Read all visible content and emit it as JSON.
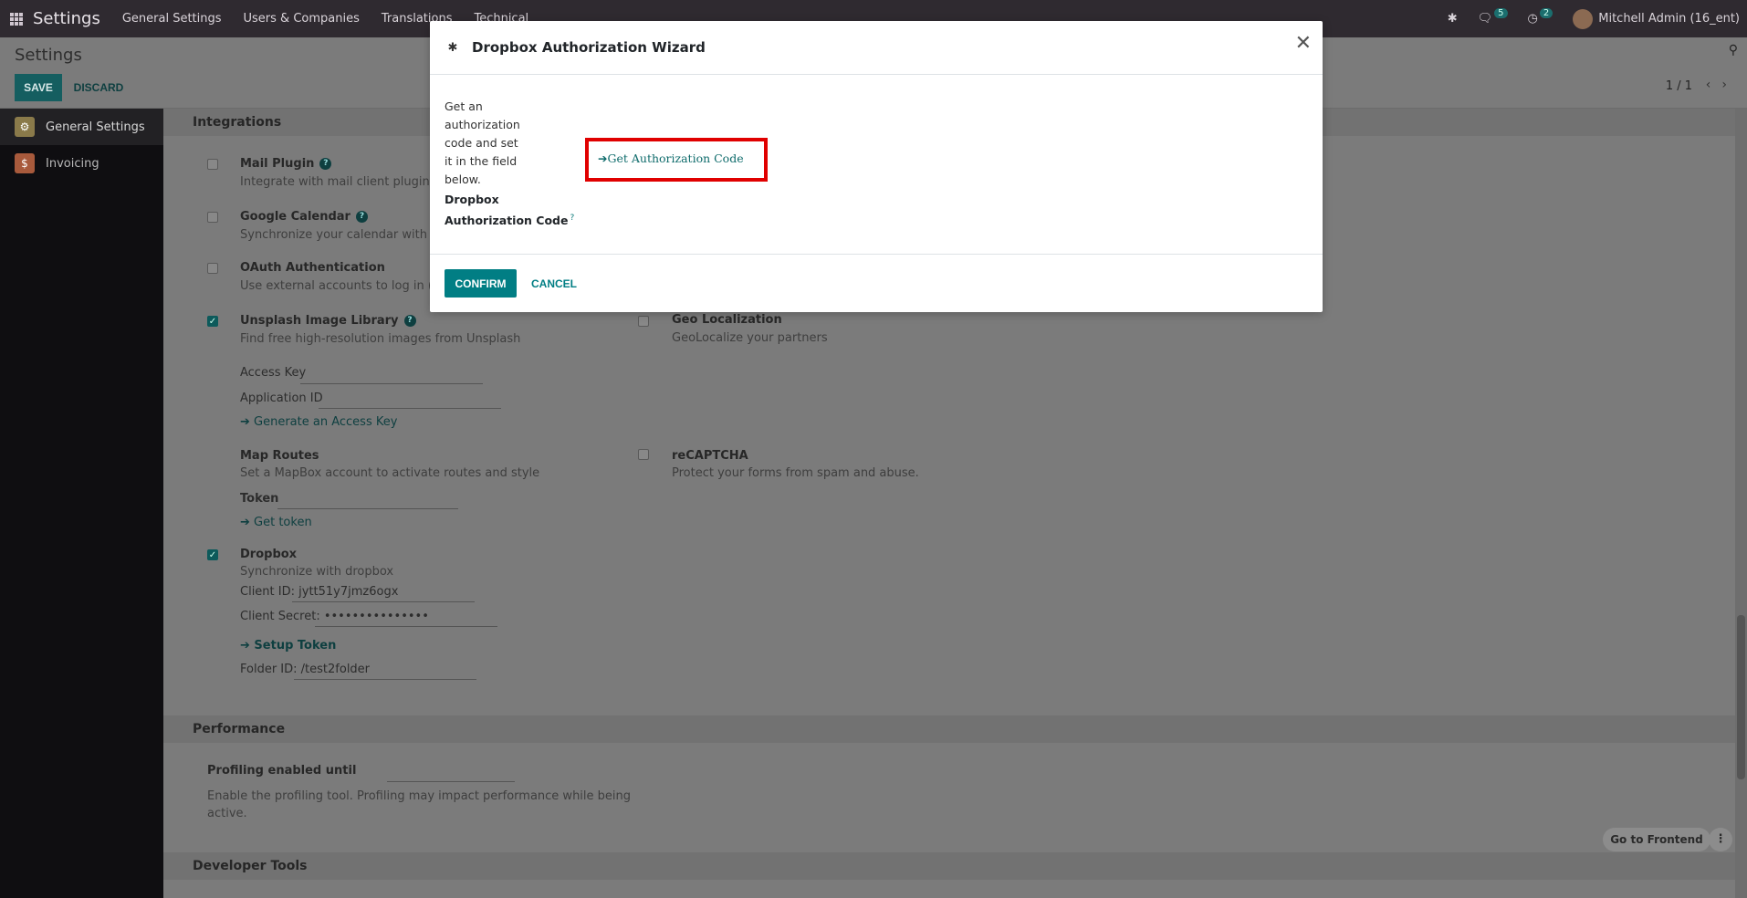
{
  "navbar": {
    "brand": "Settings",
    "menus": [
      "General Settings",
      "Users & Companies",
      "Translations",
      "Technical"
    ],
    "chat_count": "5",
    "activity_count": "2",
    "user": "Mitchell Admin (16_ent)"
  },
  "control_panel": {
    "title": "Settings",
    "save_label": "SAVE",
    "discard_label": "DISCARD",
    "pager": "1 / 1"
  },
  "sidebar": {
    "items": [
      {
        "label": "General Settings",
        "color": "#8a7a4a"
      },
      {
        "label": "Invoicing",
        "color": "#a85a3c"
      }
    ]
  },
  "content": {
    "integrations_title": "Integrations",
    "mail_plugin": {
      "title": "Mail Plugin",
      "desc": "Integrate with mail client plugins"
    },
    "google_calendar": {
      "title": "Google Calendar",
      "desc": "Synchronize your calendar with Goo"
    },
    "oauth": {
      "title": "OAuth Authentication",
      "desc": "Use external accounts to log in (Goo"
    },
    "unsplash": {
      "title": "Unsplash Image Library",
      "desc": "Find free high-resolution images from Unsplash",
      "access_key_label": "Access Key",
      "app_id_label": "Application ID",
      "generate_link": "Generate an Access Key"
    },
    "geo": {
      "title": "Geo Localization",
      "desc": "GeoLocalize your partners"
    },
    "map_routes": {
      "title": "Map Routes",
      "desc": "Set a MapBox account to activate routes and style",
      "token_label": "Token",
      "get_token_link": "Get token"
    },
    "recaptcha": {
      "title": "reCAPTCHA",
      "desc": "Protect your forms from spam and abuse."
    },
    "dropbox": {
      "title": "Dropbox",
      "desc": "Synchronize with dropbox",
      "client_id_label": "Client ID:",
      "client_id_value": "jytt51y7jmz6ogx",
      "client_secret_label": "Client Secret:",
      "client_secret_value": "•••••••••••••••",
      "setup_token_link": "Setup Token",
      "folder_id_label": "Folder ID:",
      "folder_id_value": "/test2folder"
    },
    "performance_title": "Performance",
    "profiling": {
      "title": "Profiling enabled until",
      "desc_line1": "Enable the profiling tool. Profiling may impact performance while being",
      "desc_line2": "active."
    },
    "developer_title": "Developer Tools",
    "go_frontend": "Go to Frontend"
  },
  "modal": {
    "title": "Dropbox Authorization Wizard",
    "instruction": "Get an authorization code and set it in the field below.",
    "code_label": "Dropbox Authorization Code",
    "code_help": "?",
    "auth_link": "Get Authorization Code",
    "confirm_label": "CONFIRM",
    "cancel_label": "CANCEL",
    "highlight_color": "#e00000"
  }
}
